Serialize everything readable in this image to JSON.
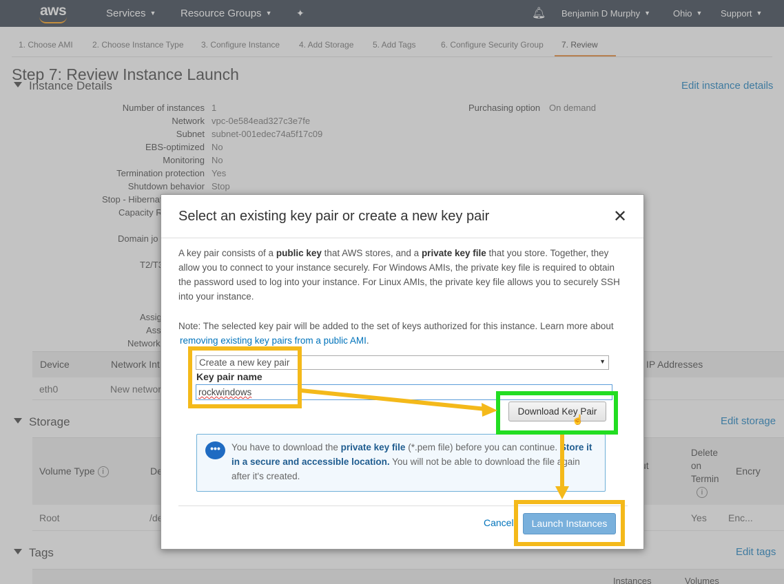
{
  "nav": {
    "logo": "aws",
    "services": "Services",
    "resource_groups": "Resource Groups",
    "pin_icon": "pin-icon",
    "bell_icon": "bell-icon",
    "user": "Benjamin D Murphy",
    "region": "Ohio",
    "support": "Support"
  },
  "steps": [
    "1. Choose AMI",
    "2. Choose Instance Type",
    "3. Configure Instance",
    "4. Add Storage",
    "5. Add Tags",
    "6. Configure Security Group",
    "7. Review"
  ],
  "page_title": "Step 7: Review Instance Launch",
  "instance_details": {
    "title": "Instance Details",
    "edit": "Edit instance details",
    "rows": [
      {
        "k": "Number of instances",
        "v": "1"
      },
      {
        "k": "Network",
        "v": "vpc-0e584ead327c3e7fe"
      },
      {
        "k": "Subnet",
        "v": "subnet-001edec74a5f17c09"
      },
      {
        "k": "EBS-optimized",
        "v": "No"
      },
      {
        "k": "Monitoring",
        "v": "No"
      },
      {
        "k": "Termination protection",
        "v": "Yes"
      },
      {
        "k": "Shutdown behavior",
        "v": "Stop"
      },
      {
        "k": "Stop - Hibernat",
        "v": ""
      },
      {
        "k": "Capacity R",
        "v": ""
      },
      {
        "k": "Domain jo",
        "v": ""
      },
      {
        "k": "T2/T3",
        "v": ""
      },
      {
        "k": "Assig",
        "v": ""
      },
      {
        "k": "Ass",
        "v": ""
      },
      {
        "k": "Network",
        "v": ""
      }
    ],
    "purchasing_label": "Purchasing option",
    "purchasing_value": "On demand"
  },
  "network_table": {
    "headers": [
      "Device",
      "Network Int",
      "IP Addresses"
    ],
    "row": [
      "eth0",
      "New networ"
    ]
  },
  "storage": {
    "title": "Storage",
    "edit": "Edit storage",
    "headers": [
      "Volume Type",
      "De",
      "ut",
      "Delete on Termin",
      "Encry"
    ],
    "row": [
      "Root",
      "/de",
      "Yes",
      "Enc..."
    ]
  },
  "tags": {
    "title": "Tags",
    "edit": "Edit tags",
    "headers": [
      "Instances",
      "Volumes"
    ]
  },
  "modal": {
    "title": "Select an existing key pair or create a new key pair",
    "close": "✕",
    "desc_1": "A key pair consists of a ",
    "desc_b1": "public key",
    "desc_2": " that AWS stores, and a ",
    "desc_b2": "private key file",
    "desc_3": " that you store. Together, they allow you to connect to your instance securely. For Windows AMIs, the private key file is required to obtain the password used to log into your instance. For Linux AMIs, the private key file allows you to securely SSH into your instance.",
    "note": "Note: The selected key pair will be added to the set of keys authorized for this instance. Learn more about ",
    "note_link": "removing existing key pairs from a public AMI",
    "note_end": ".",
    "select_value": "Create a new key pair",
    "key_pair_label": "Key pair name",
    "key_pair_value": "rockwindows",
    "download_button": "Download Key Pair",
    "info_1": "You have to download the ",
    "info_b1": "private key file",
    "info_2": " (*.pem file) before you can continue. ",
    "info_b2": "Store it in a secure and accessible location.",
    "info_3": " You will not be able to download the file again after it's created.",
    "cancel": "Cancel",
    "launch": "Launch Instances"
  },
  "colors": {
    "nav_bg": "#232f3e",
    "highlight_yellow": "#f4b91a",
    "highlight_green": "#22dd22",
    "link": "#0073bb"
  }
}
